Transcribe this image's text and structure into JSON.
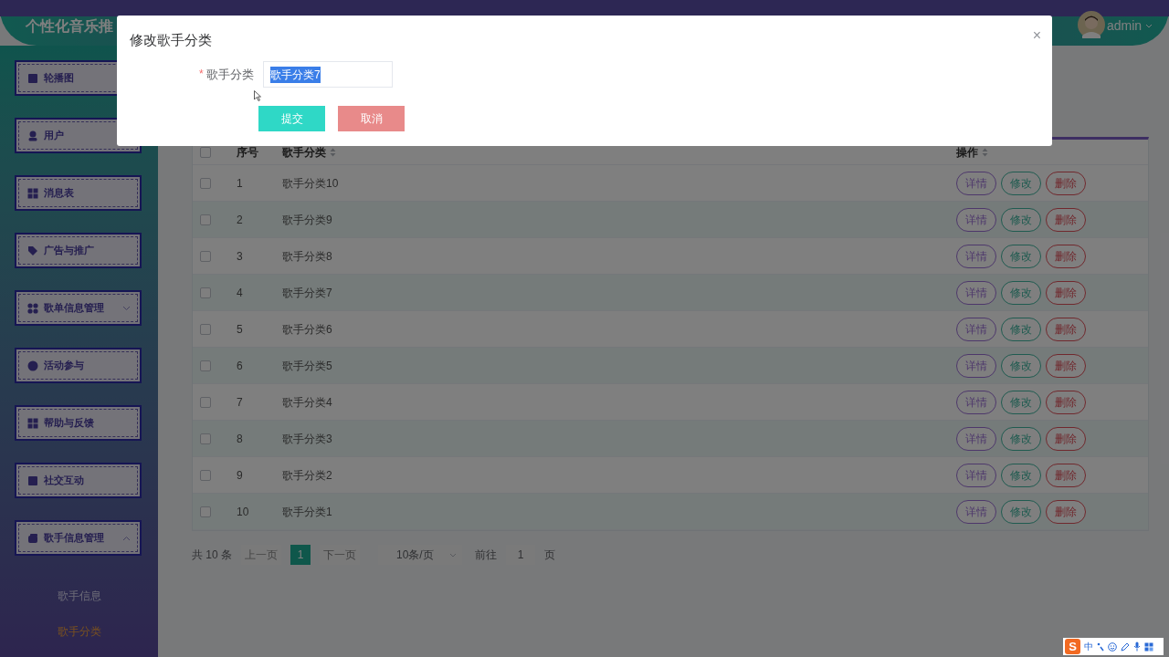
{
  "header": {
    "title": "个性化音乐推",
    "user": "admin"
  },
  "sidebar": {
    "items": [
      {
        "label": "轮播图",
        "kind": "square"
      },
      {
        "label": "用户",
        "kind": "person"
      },
      {
        "label": "消息表",
        "kind": "grid"
      },
      {
        "label": "广告与推广",
        "kind": "tag"
      },
      {
        "label": "歌单信息管理",
        "kind": "clover",
        "expanded": false
      },
      {
        "label": "活动参与",
        "kind": "circle"
      },
      {
        "label": "帮助与反馈",
        "kind": "grid"
      },
      {
        "label": "社交互动",
        "kind": "square"
      },
      {
        "label": "歌手信息管理",
        "kind": "stack",
        "expanded": true,
        "children": [
          {
            "label": "歌手信息",
            "selected": false
          },
          {
            "label": "歌手分类",
            "selected": true
          }
        ]
      }
    ]
  },
  "table": {
    "columns": [
      "序号",
      "歌手分类",
      "操作"
    ],
    "select_all_checked": false,
    "rows": [
      {
        "checked": false,
        "index": "1",
        "name": "歌手分类10",
        "actions": [
          "详情",
          "修改",
          "删除"
        ]
      },
      {
        "checked": false,
        "index": "2",
        "name": "歌手分类9",
        "actions": [
          "详情",
          "修改",
          "删除"
        ]
      },
      {
        "checked": false,
        "index": "3",
        "name": "歌手分类8",
        "actions": [
          "详情",
          "修改",
          "删除"
        ]
      },
      {
        "checked": false,
        "index": "4",
        "name": "歌手分类7",
        "actions": [
          "详情",
          "修改",
          "删除"
        ]
      },
      {
        "checked": false,
        "index": "5",
        "name": "歌手分类6",
        "actions": [
          "详情",
          "修改",
          "删除"
        ]
      },
      {
        "checked": false,
        "index": "6",
        "name": "歌手分类5",
        "actions": [
          "详情",
          "修改",
          "删除"
        ]
      },
      {
        "checked": false,
        "index": "7",
        "name": "歌手分类4",
        "actions": [
          "详情",
          "修改",
          "删除"
        ]
      },
      {
        "checked": false,
        "index": "8",
        "name": "歌手分类3",
        "actions": [
          "详情",
          "修改",
          "删除"
        ]
      },
      {
        "checked": false,
        "index": "9",
        "name": "歌手分类2",
        "actions": [
          "详情",
          "修改",
          "删除"
        ]
      },
      {
        "checked": false,
        "index": "10",
        "name": "歌手分类1",
        "actions": [
          "详情",
          "修改",
          "删除"
        ]
      }
    ]
  },
  "pagination": {
    "total": "共 10 条",
    "prev": "上一页",
    "pages": [
      {
        "label": "1",
        "selected": true
      }
    ],
    "next": "下一页",
    "page_size": "10条/页",
    "goto_label": "前往",
    "goto_value": "1",
    "goto_suffix": "页"
  },
  "dialog": {
    "title": "修改歌手分类",
    "close": "×",
    "field": {
      "label": "歌手分类",
      "required_mark": "*",
      "value": "歌手分类7",
      "value_selected": true
    },
    "buttons": [
      {
        "label": "提交",
        "kind": "primary"
      },
      {
        "label": "取消",
        "kind": "cancel"
      }
    ]
  },
  "ime_toolbar": {
    "logo": "S",
    "mode": "中"
  }
}
